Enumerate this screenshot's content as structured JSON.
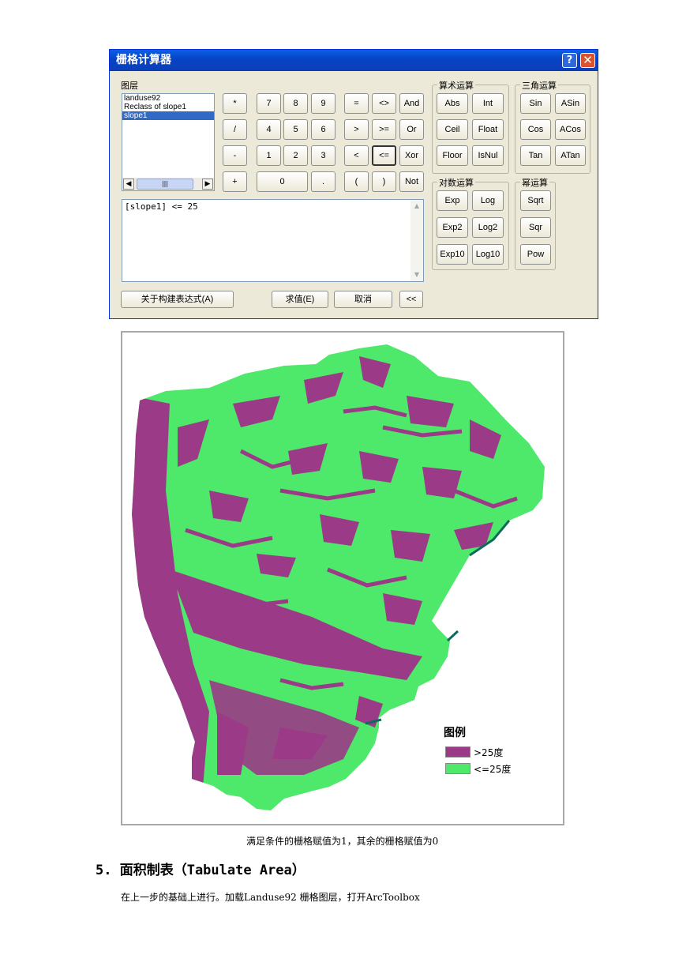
{
  "dialog": {
    "title": "栅格计算器",
    "layers_label": "图层",
    "layers": [
      "landuse92",
      "Reclass of slope1",
      "slope1"
    ],
    "expression": "[slope1] <= 25",
    "keypad": [
      "*",
      "7",
      "8",
      "9",
      "=",
      "<>",
      "And",
      "/",
      "4",
      "5",
      "6",
      ">",
      ">=",
      "Or",
      "-",
      "1",
      "2",
      "3",
      "<",
      "<=",
      "Xor",
      "+",
      "0",
      ".",
      "(",
      ")",
      "Not"
    ],
    "groups": {
      "arith": {
        "title": "算术运算",
        "buttons": [
          "Abs",
          "Int",
          "Ceil",
          "Float",
          "Floor",
          "IsNul"
        ]
      },
      "trig": {
        "title": "三角运算",
        "buttons": [
          "Sin",
          "ASin",
          "Cos",
          "ACos",
          "Tan",
          "ATan"
        ]
      },
      "log": {
        "title": "对数运算",
        "buttons": [
          "Exp",
          "Log",
          "Exp2",
          "Log2",
          "Exp10",
          "Log10"
        ]
      },
      "pow": {
        "title": "幂运算",
        "buttons": [
          "Sqrt",
          "Sqr",
          "Pow"
        ]
      }
    },
    "about_button": "关于构建表达式(A)",
    "evaluate_button": "求值(E)",
    "cancel_button": "取消",
    "collapse_button": "<<"
  },
  "map": {
    "legend_title": "图例",
    "legend_items": [
      {
        "label": ">25度",
        "color": "#9b3a86"
      },
      {
        "label": "<=25度",
        "color": "#4ee86a"
      }
    ]
  },
  "caption": "满足条件的栅格赋值为1，其余的栅格赋值为0",
  "heading": "5. 面积制表（Tabulate Area）",
  "paragraph": "在上一步的基础上进行。加载Landuse92 栅格图层，打开ArcToolbox"
}
